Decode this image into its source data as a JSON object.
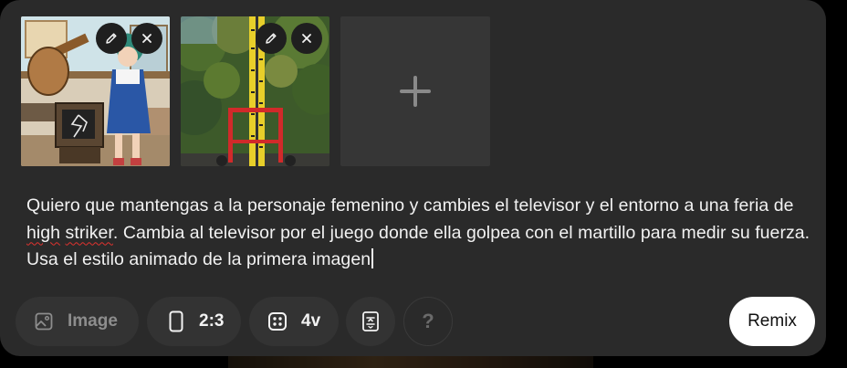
{
  "thumbnails": [
    {
      "name": "hammer-tv-anime-image"
    },
    {
      "name": "high-striker-tower-photo"
    }
  ],
  "prompt": {
    "part1": "Quiero que mantengas a la personaje femenino y cambies el televisor y el entorno a una feria de ",
    "misspelled1": "high",
    "space": " ",
    "misspelled2": "striker",
    "part2": ". Cambia al televisor por el juego donde ella golpea con el martillo para medir su fuerza. Usa el estilo animado de la primera imagen"
  },
  "toolbar": {
    "image_label": "Image",
    "ratio_label": "2:3",
    "variants_label": "4v",
    "help_label": "?",
    "remix_label": "Remix"
  },
  "colors": {
    "panel": "#2a2a2a",
    "pill": "#333333",
    "spellcheck": "#e0332f",
    "remix_bg": "#ffffff"
  }
}
